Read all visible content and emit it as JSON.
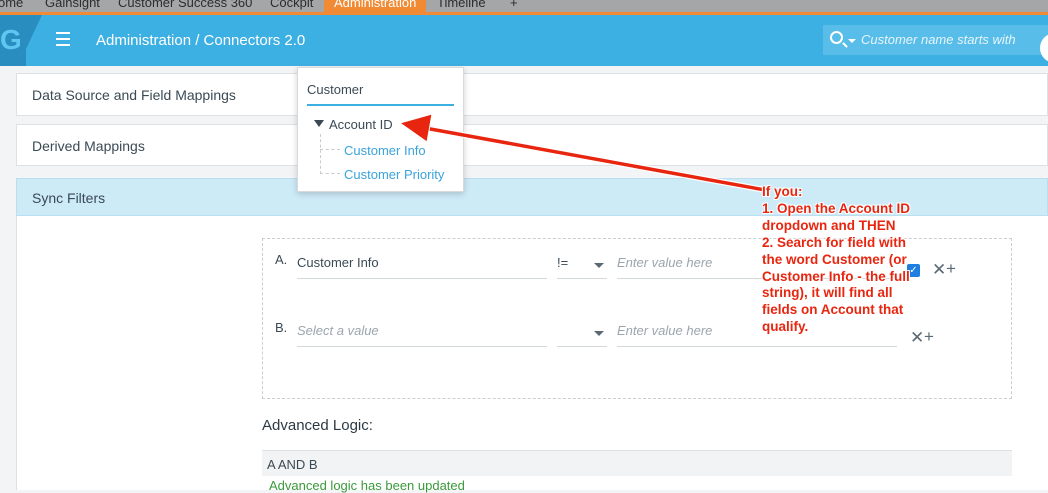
{
  "top_tabs": [
    {
      "label": "ome",
      "active": false
    },
    {
      "label": "Gainsight",
      "active": false
    },
    {
      "label": "Customer Success 360",
      "active": false
    },
    {
      "label": "Cockpit",
      "active": false
    },
    {
      "label": "Administration",
      "active": true
    },
    {
      "label": "Timeline",
      "active": false
    },
    {
      "label": "+",
      "active": false
    }
  ],
  "header": {
    "logo_letter": "G",
    "breadcrumb": "Administration / Connectors 2.0",
    "search_placeholder": "Customer name starts with"
  },
  "sections": {
    "data_source": "Data Source and Field Mappings",
    "derived": "Derived Mappings",
    "sync_filters": "Sync Filters"
  },
  "dropdown": {
    "search_value": "Customer",
    "parent": "Account ID",
    "children": [
      "Customer Info",
      "Customer Priority"
    ]
  },
  "filters": [
    {
      "letter": "A.",
      "field": "Customer Info",
      "field_is_placeholder": false,
      "operator": "!=",
      "value_placeholder": "Enter value here",
      "has_checkbox": true
    },
    {
      "letter": "B.",
      "field": "Select a value",
      "field_is_placeholder": true,
      "operator": "",
      "value_placeholder": "Enter value here",
      "has_checkbox": false
    }
  ],
  "advanced": {
    "label": "Advanced Logic:",
    "expression": "A AND B",
    "status": "Advanced logic has been updated"
  },
  "annotation": {
    "text": "If you:\n1. Open the Account ID dropdown and THEN\n2. Search for field with the word Customer (or Customer Info - the full string), it will find all fields on Account that qualify."
  },
  "colors": {
    "header": "#3db0e3",
    "active_tab": "#f08a34",
    "annotation": "#e8260f",
    "link": "#3aa3db"
  }
}
